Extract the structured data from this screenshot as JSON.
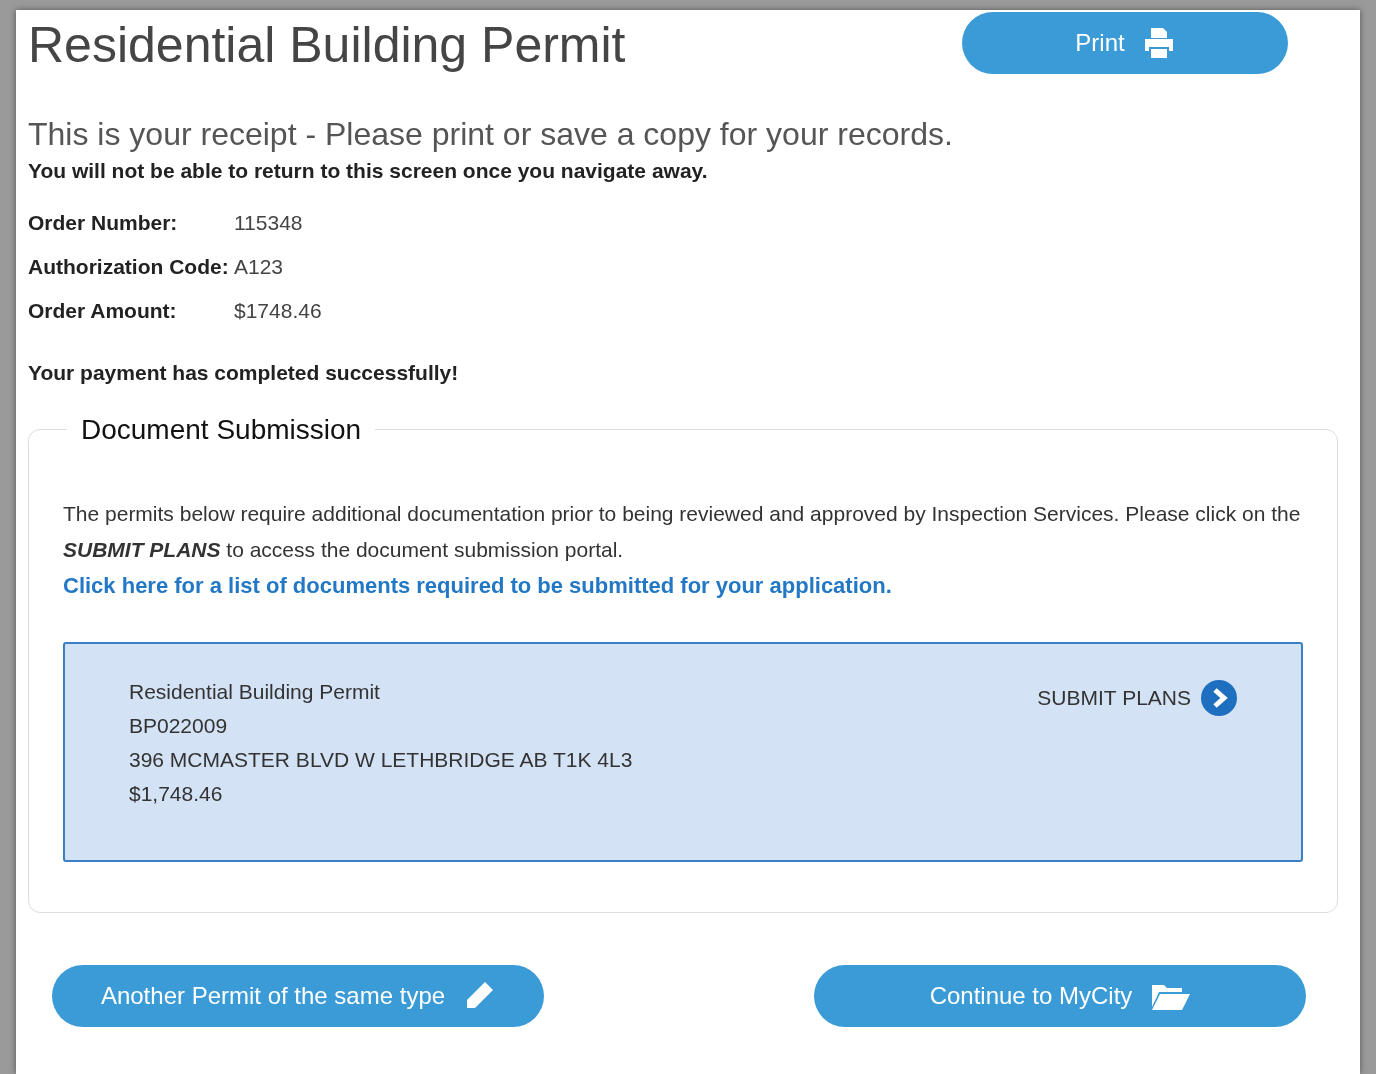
{
  "title": "Residential Building Permit",
  "print_button": {
    "label": "Print"
  },
  "receipt_heading": "This is your receipt - Please print or save a copy for your records.",
  "warning": "You will not be able to return to this screen once you navigate away.",
  "details": [
    {
      "label": "Order Number:",
      "value": "115348"
    },
    {
      "label": "Authorization Code:",
      "value": "A123"
    },
    {
      "label": "Order Amount:",
      "value": "$1748.46"
    }
  ],
  "success_message": "Your payment has completed successfully!",
  "document_submission": {
    "legend": "Document Submission",
    "intro": "The permits below require additional documentation prior to being reviewed and approved by Inspection Services. Please click on the *SUBMIT PLANS* to access the document submission portal.",
    "link": "Click here for a list of documents required to be submitted for your application.",
    "permit": {
      "lines": [
        "Residential Building Permit",
        "BP022009",
        "396 MCMASTER BLVD W LETHBRIDGE AB T1K 4L3",
        "$1,748.46"
      ],
      "action": "SUBMIT PLANS"
    }
  },
  "buttons": [
    {
      "kind": "edit",
      "label": "Another Permit of the same type"
    },
    {
      "kind": "folder",
      "label": "Continue to MyCity"
    }
  ]
}
